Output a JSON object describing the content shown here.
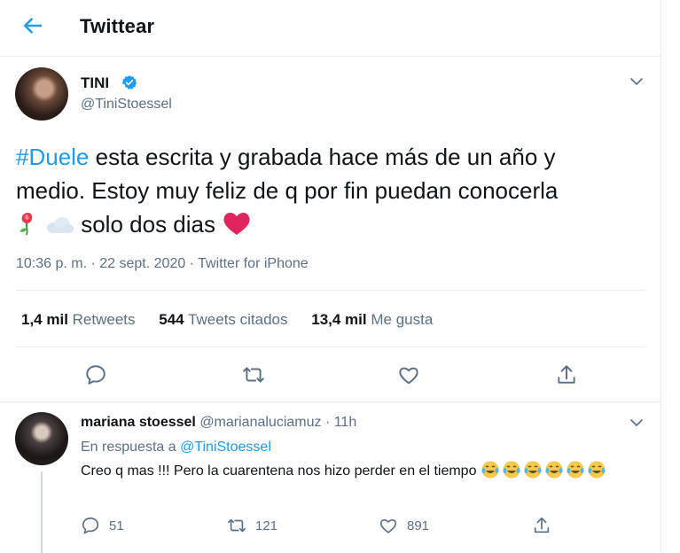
{
  "header": {
    "title": "Twittear"
  },
  "tweet": {
    "author_name": "TINI",
    "author_handle": "@TiniStoessel",
    "hashtag": "#Duele",
    "text_line1": " esta escrita y grabada hace más de un año y",
    "text_line2": "medio. Estoy muy feliz de q por fin puedan conocerla",
    "text_line3": " solo dos dias",
    "meta": "10:36 p. m. · 22 sept. 2020 · Twitter for iPhone",
    "stats": [
      {
        "value": "1,4 mil",
        "label": "Retweets"
      },
      {
        "value": "544",
        "label": "Tweets citados"
      },
      {
        "value": "13,4 mil",
        "label": "Me gusta"
      }
    ],
    "emojis": [
      "rose-emoji",
      "cloud-emoji",
      "red-heart-emoji"
    ]
  },
  "reply": {
    "author_name": "mariana stoessel",
    "author_handle": "@marianaluciamuz",
    "separator": " · ",
    "time": "11h",
    "in_reply_prefix": "En respuesta a ",
    "in_reply_link": "@TiniStoessel",
    "text": "Creo q mas !!! Pero la cuarentena nos hizo perder en el tiempo ",
    "laugh_emoji_count": 6,
    "actions": {
      "replies": "51",
      "retweets": "121",
      "likes": "891"
    }
  },
  "colors": {
    "accent": "#1d9bf0",
    "muted_text": "#5b7083",
    "heart_red": "#e0245e",
    "divider": "#e6ecf0"
  }
}
